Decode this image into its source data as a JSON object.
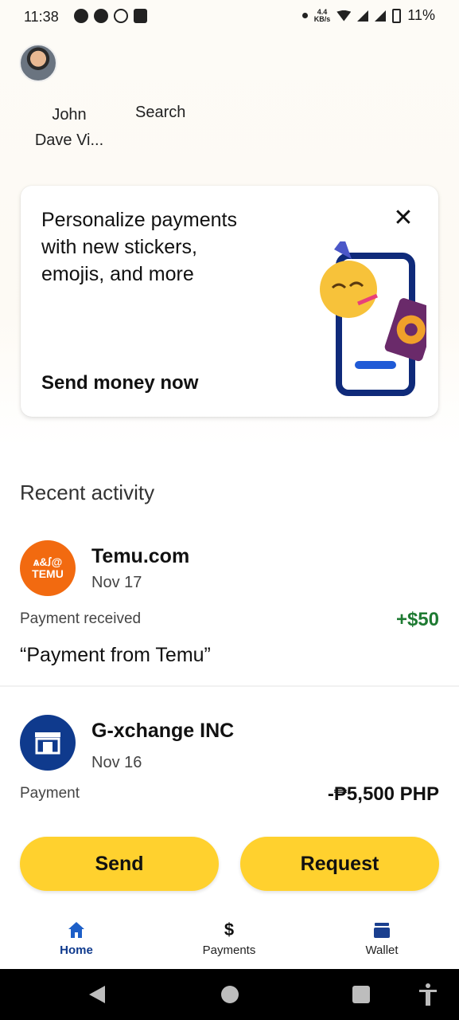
{
  "status_bar": {
    "time": "11:38",
    "net_speed_value": "4.4",
    "net_speed_unit": "KB/s",
    "battery": "11%"
  },
  "profile": {
    "name_line1": "John",
    "name_line2": "Dave Vi..."
  },
  "header": {
    "search_label": "Search"
  },
  "promo": {
    "line1": "Personalize payments",
    "line2": "with new stickers,",
    "line3": "emojis, and more",
    "close_symbol": "✕",
    "cta": "Send money now"
  },
  "recent": {
    "title": "Recent activity",
    "transactions": [
      {
        "name": "Temu.com",
        "date": "Nov 17",
        "type": "Payment received",
        "amount": "+$50",
        "note": "“Payment from Temu”",
        "logo_top": "ѧ&ꭍ@",
        "logo_text": "TEMU"
      },
      {
        "name": "G-xchange INC",
        "date": "Nov 16",
        "type": "Payment",
        "amount": "-₱5,500 PHP"
      }
    ]
  },
  "actions": {
    "send": "Send",
    "request": "Request"
  },
  "nav": {
    "home": "Home",
    "payments": "Payments",
    "wallet": "Wallet",
    "payments_symbol": "$"
  },
  "colors": {
    "accent_yellow": "#ffd12e",
    "brand_blue": "#0f3a8d",
    "positive_green": "#1e7a32",
    "temu_orange": "#f26a10"
  },
  "icons": {
    "promo_close": "close-icon",
    "home": "home-icon",
    "payments": "dollar-icon",
    "wallet": "wallet-icon",
    "gxchange": "storefront-icon"
  }
}
